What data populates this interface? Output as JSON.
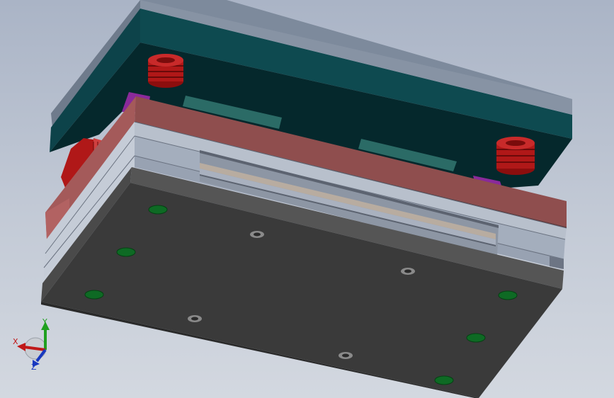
{
  "viewport": {
    "background_top": "#aab4c6",
    "background_bottom": "#d3d8e0"
  },
  "model": {
    "components": [
      "top-clamp-plate",
      "cavity-plate",
      "stripper-plate",
      "core-plate",
      "support-plate",
      "bottom-clamp-plate",
      "return-springs",
      "leader-pins",
      "screw-holes"
    ],
    "colors": {
      "top_plate_face": "#0a3e44",
      "top_plate_edge": "#7d8a9c",
      "top_plate_underside": "#06262a",
      "cavity_plate": "#8f4e4e",
      "core_plates": "#a4aebd",
      "bottom_plate": "#3a3a3a",
      "bottom_plate_edge": "#555555",
      "green_holes": "#0e6a24",
      "springs": "#b01818",
      "purple_parts": "#8a2a9a",
      "insert_slabs": "#2b6b66"
    }
  },
  "triad": {
    "x_label": "X",
    "y_label": "Y",
    "z_label": "Z",
    "x_color": "#c01818",
    "y_color": "#1fa01f",
    "z_color": "#1838c0"
  }
}
